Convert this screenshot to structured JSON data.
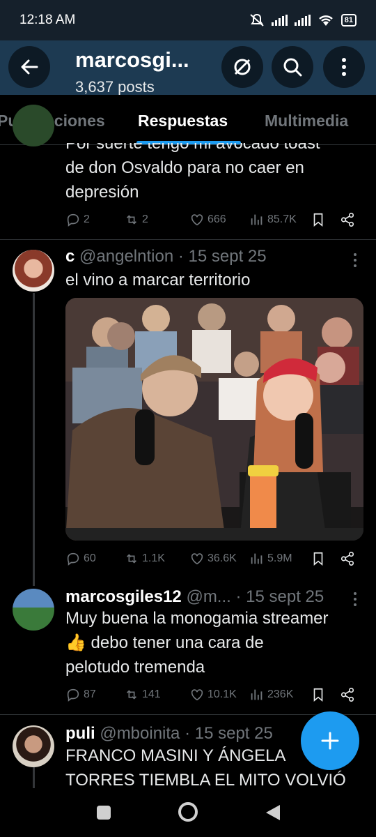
{
  "status_bar": {
    "time": "12:18 AM",
    "battery": "81"
  },
  "header": {
    "title": "marcosgi...",
    "subtitle": "3,637 posts"
  },
  "tabs": [
    {
      "label": "Publicaciones",
      "active": false
    },
    {
      "label": "Respuestas",
      "active": true
    },
    {
      "label": "Multimedia",
      "active": false
    }
  ],
  "tweets": [
    {
      "text_lines": [
        "Por suerte tengo mi avocado toast",
        "de don Osvaldo para no caer en",
        "depresión"
      ],
      "replies": "2",
      "retweets": "2",
      "likes": "666",
      "views": "85.7K"
    },
    {
      "name": "c",
      "handle": "@angelntion",
      "date": "· 15 sept 25",
      "text_lines": [
        "el vino a marcar territorio"
      ],
      "replies": "60",
      "retweets": "1.1K",
      "likes": "36.6K",
      "views": "5.9M"
    },
    {
      "name": "marcosgiles12",
      "handle": "@m...",
      "date": "· 15 sept 25",
      "text_lines": [
        "Muy buena la monogamia streamer",
        "👍 debo tener una cara de",
        "pelotudo tremenda"
      ],
      "replies": "87",
      "retweets": "141",
      "likes": "10.1K",
      "views": "236K"
    },
    {
      "name": "puli",
      "handle": "@mboinita",
      "date": "· 15 sept 25",
      "text_lines": [
        "FRANCO MASINI Y ÁNGELA",
        "TORRES TIEMBLA EL MITO VOLVIÓ"
      ]
    }
  ],
  "icons": {
    "back": "arrow-left-icon",
    "nofollow": "no-follow-icon",
    "search": "search-icon",
    "more": "more-vertical-icon",
    "reply": "reply-icon",
    "retweet": "retweet-icon",
    "like": "heart-icon",
    "views": "views-icon",
    "bookmark": "bookmark-icon",
    "share": "share-icon",
    "compose": "plus-icon"
  },
  "colors": {
    "accent": "#1d9bf0",
    "header_bg": "#1d3a52",
    "muted": "#71767b"
  }
}
